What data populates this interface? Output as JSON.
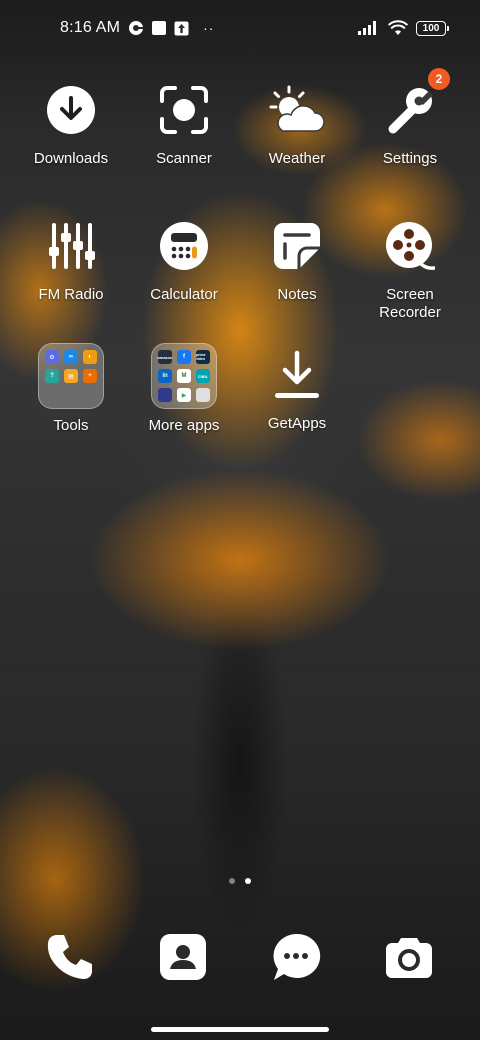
{
  "status_bar": {
    "time": "8:16 AM",
    "battery": "100",
    "overflow": "··"
  },
  "apps": [
    {
      "label": "Downloads",
      "icon": "download-icon"
    },
    {
      "label": "Scanner",
      "icon": "scanner-icon"
    },
    {
      "label": "Weather",
      "icon": "weather-icon"
    },
    {
      "label": "Settings",
      "icon": "settings-icon",
      "badge": "2"
    },
    {
      "label": "FM Radio",
      "icon": "equalizer-icon"
    },
    {
      "label": "Calculator",
      "icon": "calculator-icon"
    },
    {
      "label": "Notes",
      "icon": "notes-icon"
    },
    {
      "label": "Screen Recorder",
      "icon": "film-reel-icon"
    },
    {
      "label": "Tools",
      "icon": "folder-icon"
    },
    {
      "label": "More apps",
      "icon": "folder-icon"
    },
    {
      "label": "GetApps",
      "icon": "download-tray-icon"
    }
  ],
  "more_apps_folder": {
    "mini_labels": [
      "amazon",
      "f",
      "prime video",
      "in",
      "M",
      "CIBIL",
      "",
      "▶",
      ""
    ]
  },
  "page_indicator": {
    "pages": 2,
    "current": 2
  },
  "dock": [
    {
      "icon": "phone-icon"
    },
    {
      "icon": "contacts-icon"
    },
    {
      "icon": "messages-icon"
    },
    {
      "icon": "camera-icon"
    }
  ],
  "colors": {
    "badge": "#f05a23",
    "accent_orange": "#f0961a"
  }
}
